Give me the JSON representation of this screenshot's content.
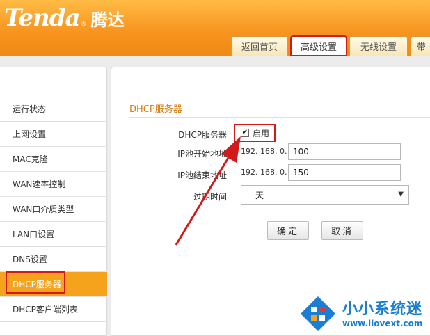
{
  "header": {
    "logo_en": "Tenda",
    "logo_reg": "®",
    "logo_cn": "腾达"
  },
  "tabs": [
    {
      "label": "返回首页",
      "active": false
    },
    {
      "label": "高级设置",
      "active": true
    },
    {
      "label": "无线设置",
      "active": false
    },
    {
      "label": "带",
      "active": false
    }
  ],
  "sidebar": {
    "items": [
      {
        "label": "运行状态"
      },
      {
        "label": "上网设置"
      },
      {
        "label": "MAC克隆"
      },
      {
        "label": "WAN速率控制"
      },
      {
        "label": "WAN口介质类型"
      },
      {
        "label": "LAN口设置"
      },
      {
        "label": "DNS设置"
      },
      {
        "label": "DHCP服务器",
        "active": true
      },
      {
        "label": "DHCP客户端列表"
      }
    ]
  },
  "main": {
    "section_title": "DHCP服务器",
    "dhcp_label": "DHCP服务器",
    "dhcp_enable_label": "启用",
    "dhcp_enabled": true,
    "check_mark": "✔",
    "ip_start_label": "IP池开始地址",
    "ip_start_prefix": "192. 168. 0.",
    "ip_start_value": "100",
    "ip_end_label": "IP池结束地址",
    "ip_end_prefix": "192. 168. 0.",
    "ip_end_value": "150",
    "lease_label": "过期时间",
    "lease_value": "一天",
    "lease_arrow": "▼",
    "ok_button": "确定",
    "cancel_button": "取消"
  },
  "watermark": {
    "name": "小小系统迷",
    "url": "www.ilovext.com"
  },
  "colors": {
    "brand_orange": "#f7931e",
    "active_item": "#f5a31c",
    "highlight_red": "#d21a1a",
    "section_title": "#d87a10",
    "watermark_blue": "#1a7fd4"
  }
}
